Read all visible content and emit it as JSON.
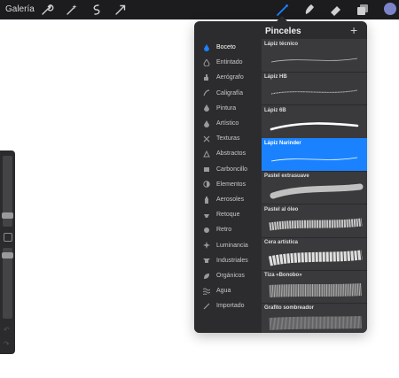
{
  "topbar": {
    "gallery_label": "Galería",
    "tools_left": [
      "wrench-icon",
      "magic-wand-icon",
      "selection-icon",
      "transform-arrow-icon"
    ],
    "tools_right": [
      "brush-icon",
      "smudge-icon",
      "eraser-icon",
      "layers-icon",
      "color-swatch"
    ],
    "accent_color": "#1a82ff",
    "active_color": "#7c84c9"
  },
  "brush_library": {
    "title": "Pinceles",
    "add_label": "+",
    "categories": [
      {
        "label": "Boceto",
        "icon": "pencil-drop-icon",
        "active": true
      },
      {
        "label": "Entintado",
        "icon": "ink-drop-icon",
        "active": false
      },
      {
        "label": "Aerógrafo",
        "icon": "airbrush-icon",
        "active": false
      },
      {
        "label": "Caligrafía",
        "icon": "calligraphy-icon",
        "active": false
      },
      {
        "label": "Pintura",
        "icon": "paint-drop-icon",
        "active": false
      },
      {
        "label": "Artístico",
        "icon": "artistic-drop-icon",
        "active": false
      },
      {
        "label": "Texturas",
        "icon": "texture-icon",
        "active": false
      },
      {
        "label": "Abstractos",
        "icon": "triangle-icon",
        "active": false
      },
      {
        "label": "Carboncillo",
        "icon": "charcoal-icon",
        "active": false
      },
      {
        "label": "Elementos",
        "icon": "yin-yang-icon",
        "active": false
      },
      {
        "label": "Aerosoles",
        "icon": "spray-icon",
        "active": false
      },
      {
        "label": "Retoque",
        "icon": "retouch-icon",
        "active": false
      },
      {
        "label": "Retro",
        "icon": "retro-icon",
        "active": false
      },
      {
        "label": "Luminancia",
        "icon": "sparkle-icon",
        "active": false
      },
      {
        "label": "Industriales",
        "icon": "anvil-icon",
        "active": false
      },
      {
        "label": "Orgánicos",
        "icon": "leaf-icon",
        "active": false
      },
      {
        "label": "Agua",
        "icon": "water-icon",
        "active": false
      },
      {
        "label": "Importado",
        "icon": "import-icon",
        "active": false
      }
    ],
    "brushes": [
      {
        "name": "Lápiz técnico",
        "stroke": "thin",
        "selected": false
      },
      {
        "name": "Lápiz HB",
        "stroke": "pencil",
        "selected": false
      },
      {
        "name": "Lápiz 6B",
        "stroke": "bold",
        "selected": false
      },
      {
        "name": "Lápiz Narinder",
        "stroke": "thin",
        "selected": true
      },
      {
        "name": "Pastel extrasuave",
        "stroke": "pastel",
        "selected": false
      },
      {
        "name": "Pastel al óleo",
        "stroke": "oil",
        "selected": false
      },
      {
        "name": "Cera artística",
        "stroke": "wax",
        "selected": false
      },
      {
        "name": "Tiza «Bonobo»",
        "stroke": "chalk",
        "selected": false
      },
      {
        "name": "Grafito sombreador",
        "stroke": "graphite",
        "selected": false
      }
    ]
  }
}
